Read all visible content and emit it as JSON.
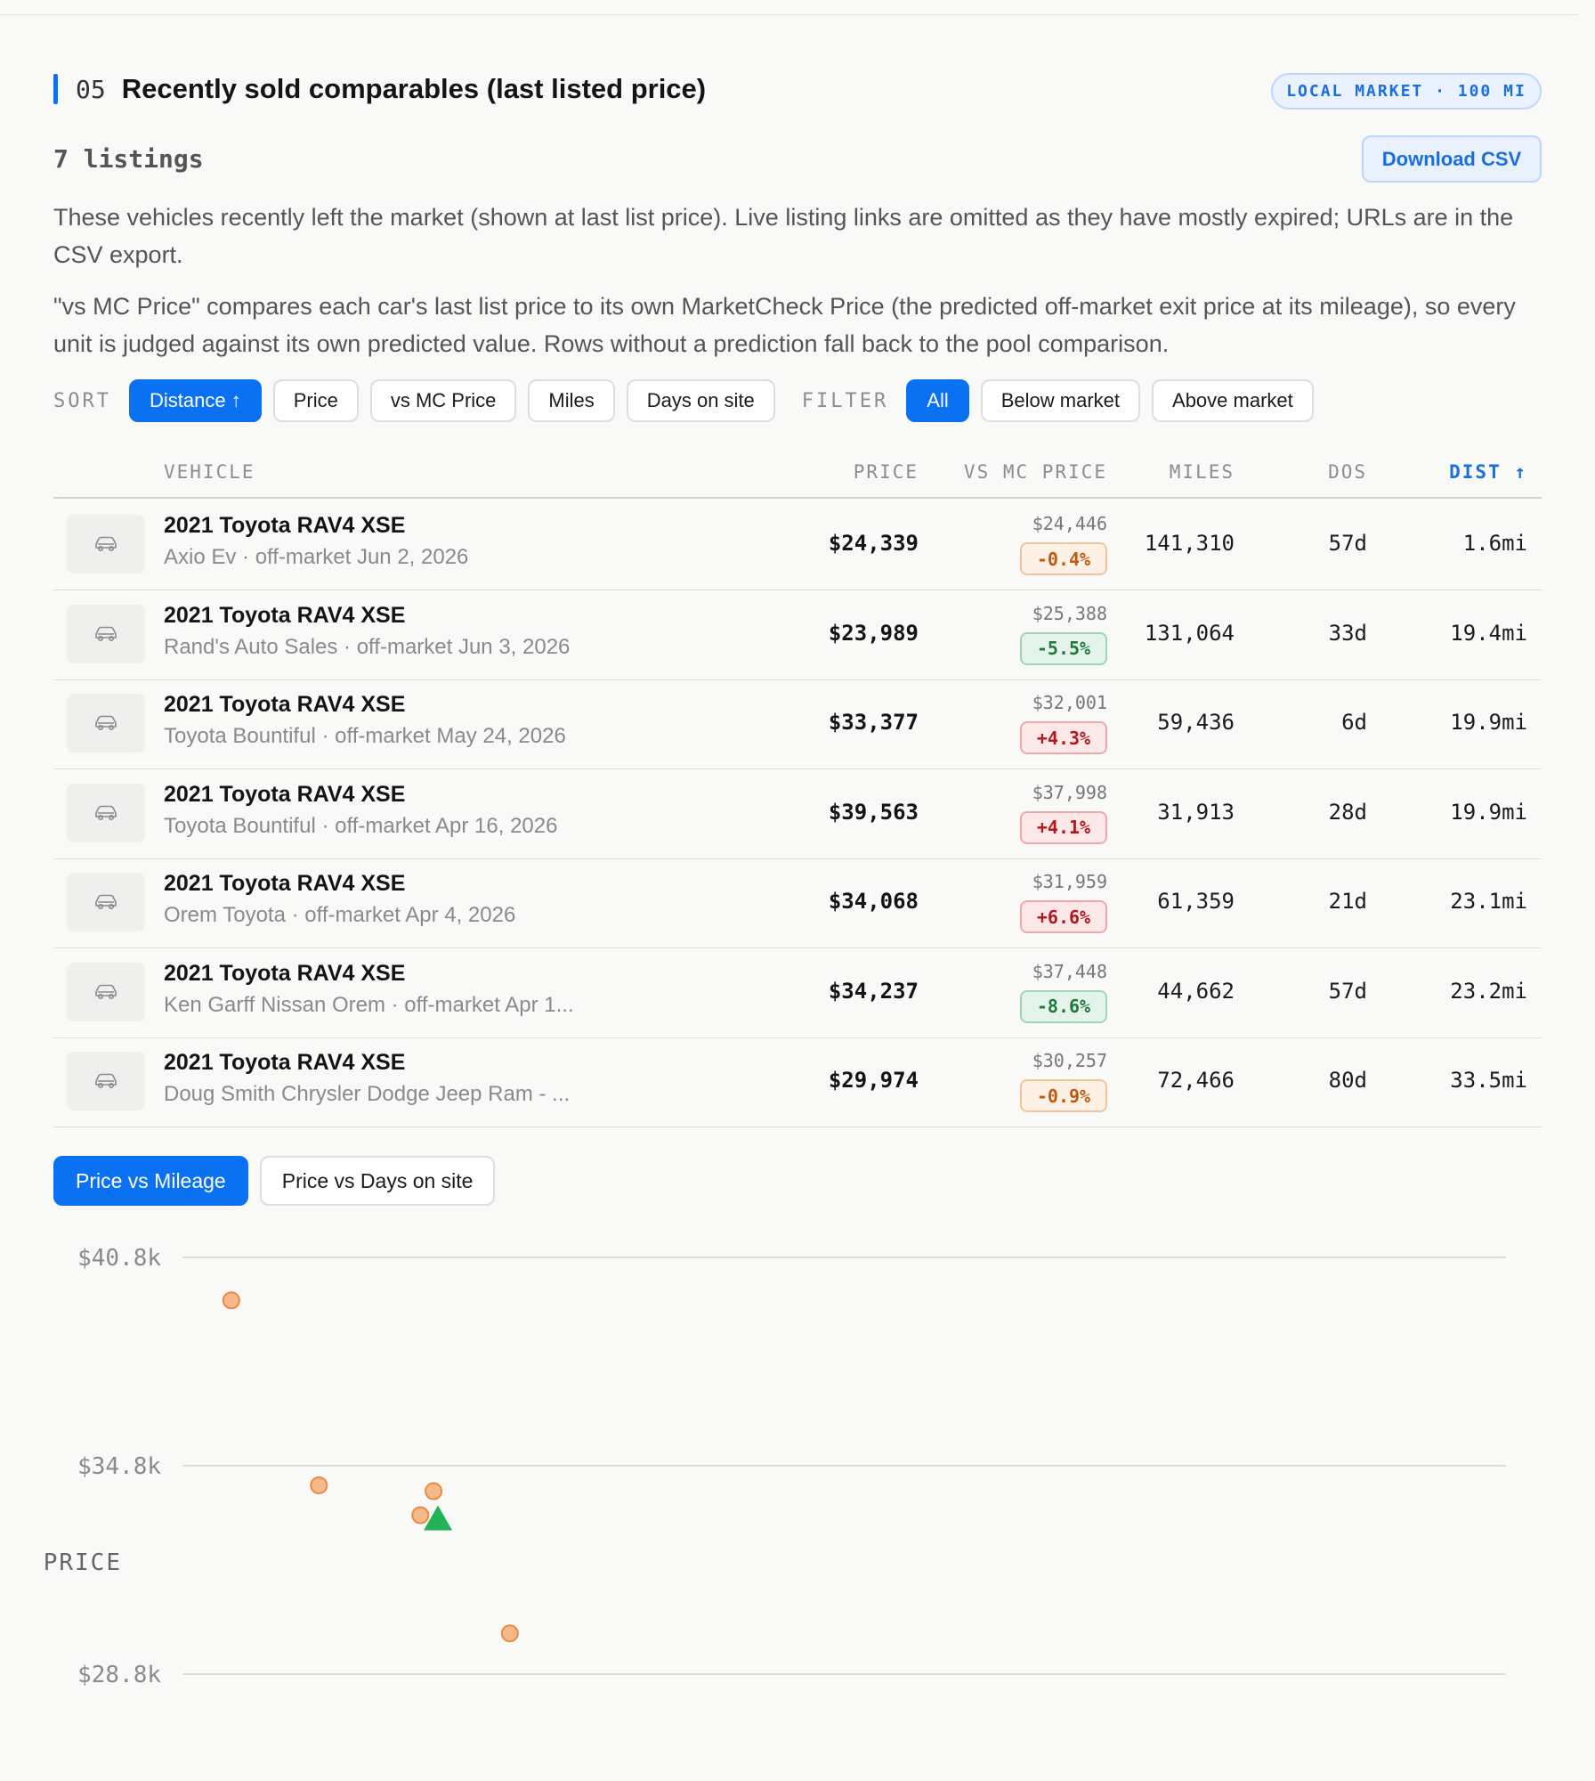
{
  "section": {
    "number": "05",
    "title": "Recently sold comparables (last listed price)",
    "badge": "LOCAL MARKET · 100 MI",
    "count": "7 listings",
    "download_label": "Download CSV",
    "para1": "These vehicles recently left the market (shown at last list price). Live listing links are omitted as they have mostly expired; URLs are in the CSV export.",
    "para2": "\"vs MC Price\" compares each car's last list price to its own MarketCheck Price (the predicted off-market exit price at its mileage), so every unit is judged against its own predicted value. Rows without a prediction fall back to the pool comparison."
  },
  "controls": {
    "sort_label": "SORT",
    "sort_options": [
      "Distance ↑",
      "Price",
      "vs MC Price",
      "Miles",
      "Days on site"
    ],
    "filter_label": "FILTER",
    "filter_options": [
      "All",
      "Below market",
      "Above market"
    ]
  },
  "table": {
    "headers": {
      "vehicle": "VEHICLE",
      "price": "PRICE",
      "vs_mc": "VS MC PRICE",
      "miles": "MILES",
      "dos": "DOS",
      "dist": "DIST ↑"
    },
    "rows": [
      {
        "name": "2021 Toyota RAV4 XSE",
        "sub": "Axio Ev · off-market Jun 2, 2026",
        "price": "$24,339",
        "mc": "$24,446",
        "pct": "-0.4%",
        "tone": "neutral",
        "miles": "141,310",
        "dos": "57d",
        "dist": "1.6mi"
      },
      {
        "name": "2021 Toyota RAV4 XSE",
        "sub": "Rand's Auto Sales · off-market Jun 3, 2026",
        "price": "$23,989",
        "mc": "$25,388",
        "pct": "-5.5%",
        "tone": "good",
        "miles": "131,064",
        "dos": "33d",
        "dist": "19.4mi"
      },
      {
        "name": "2021 Toyota RAV4 XSE",
        "sub": "Toyota Bountiful · off-market May 24, 2026",
        "price": "$33,377",
        "mc": "$32,001",
        "pct": "+4.3%",
        "tone": "bad",
        "miles": "59,436",
        "dos": "6d",
        "dist": "19.9mi"
      },
      {
        "name": "2021 Toyota RAV4 XSE",
        "sub": "Toyota Bountiful · off-market Apr 16, 2026",
        "price": "$39,563",
        "mc": "$37,998",
        "pct": "+4.1%",
        "tone": "bad",
        "miles": "31,913",
        "dos": "28d",
        "dist": "19.9mi"
      },
      {
        "name": "2021 Toyota RAV4 XSE",
        "sub": "Orem Toyota · off-market Apr 4, 2026",
        "price": "$34,068",
        "mc": "$31,959",
        "pct": "+6.6%",
        "tone": "bad",
        "miles": "61,359",
        "dos": "21d",
        "dist": "23.1mi"
      },
      {
        "name": "2021 Toyota RAV4 XSE",
        "sub": "Ken Garff Nissan Orem · off-market Apr 1...",
        "price": "$34,237",
        "mc": "$37,448",
        "pct": "-8.6%",
        "tone": "good",
        "miles": "44,662",
        "dos": "57d",
        "dist": "23.2mi"
      },
      {
        "name": "2021 Toyota RAV4 XSE",
        "sub": "Doug Smith Chrysler Dodge Jeep Ram - ...",
        "price": "$29,974",
        "mc": "$30,257",
        "pct": "-0.9%",
        "tone": "neutral",
        "miles": "72,466",
        "dos": "80d",
        "dist": "33.5mi"
      }
    ]
  },
  "chart_tabs": [
    "Price vs Mileage",
    "Price vs Days on site"
  ],
  "chart_data": {
    "type": "scatter",
    "ylabel": "PRICE",
    "yticks": [
      "$40.8k",
      "$34.8k",
      "$28.8k"
    ],
    "ytick_values": [
      40800,
      34800,
      28800
    ],
    "ylim": [
      28800,
      40800
    ],
    "xlim": [
      24800,
      217500
    ],
    "series": [
      {
        "marker": "circle",
        "color": "#f7b98a",
        "points": [
          {
            "x": 31913,
            "y": 39563
          },
          {
            "x": 44662,
            "y": 34237
          },
          {
            "x": 59436,
            "y": 33377
          },
          {
            "x": 61359,
            "y": 34068
          },
          {
            "x": 72466,
            "y": 29974
          }
        ]
      },
      {
        "marker": "triangle",
        "color": "#22b358",
        "points": [
          {
            "x": 62000,
            "y": 33300
          }
        ]
      }
    ]
  }
}
